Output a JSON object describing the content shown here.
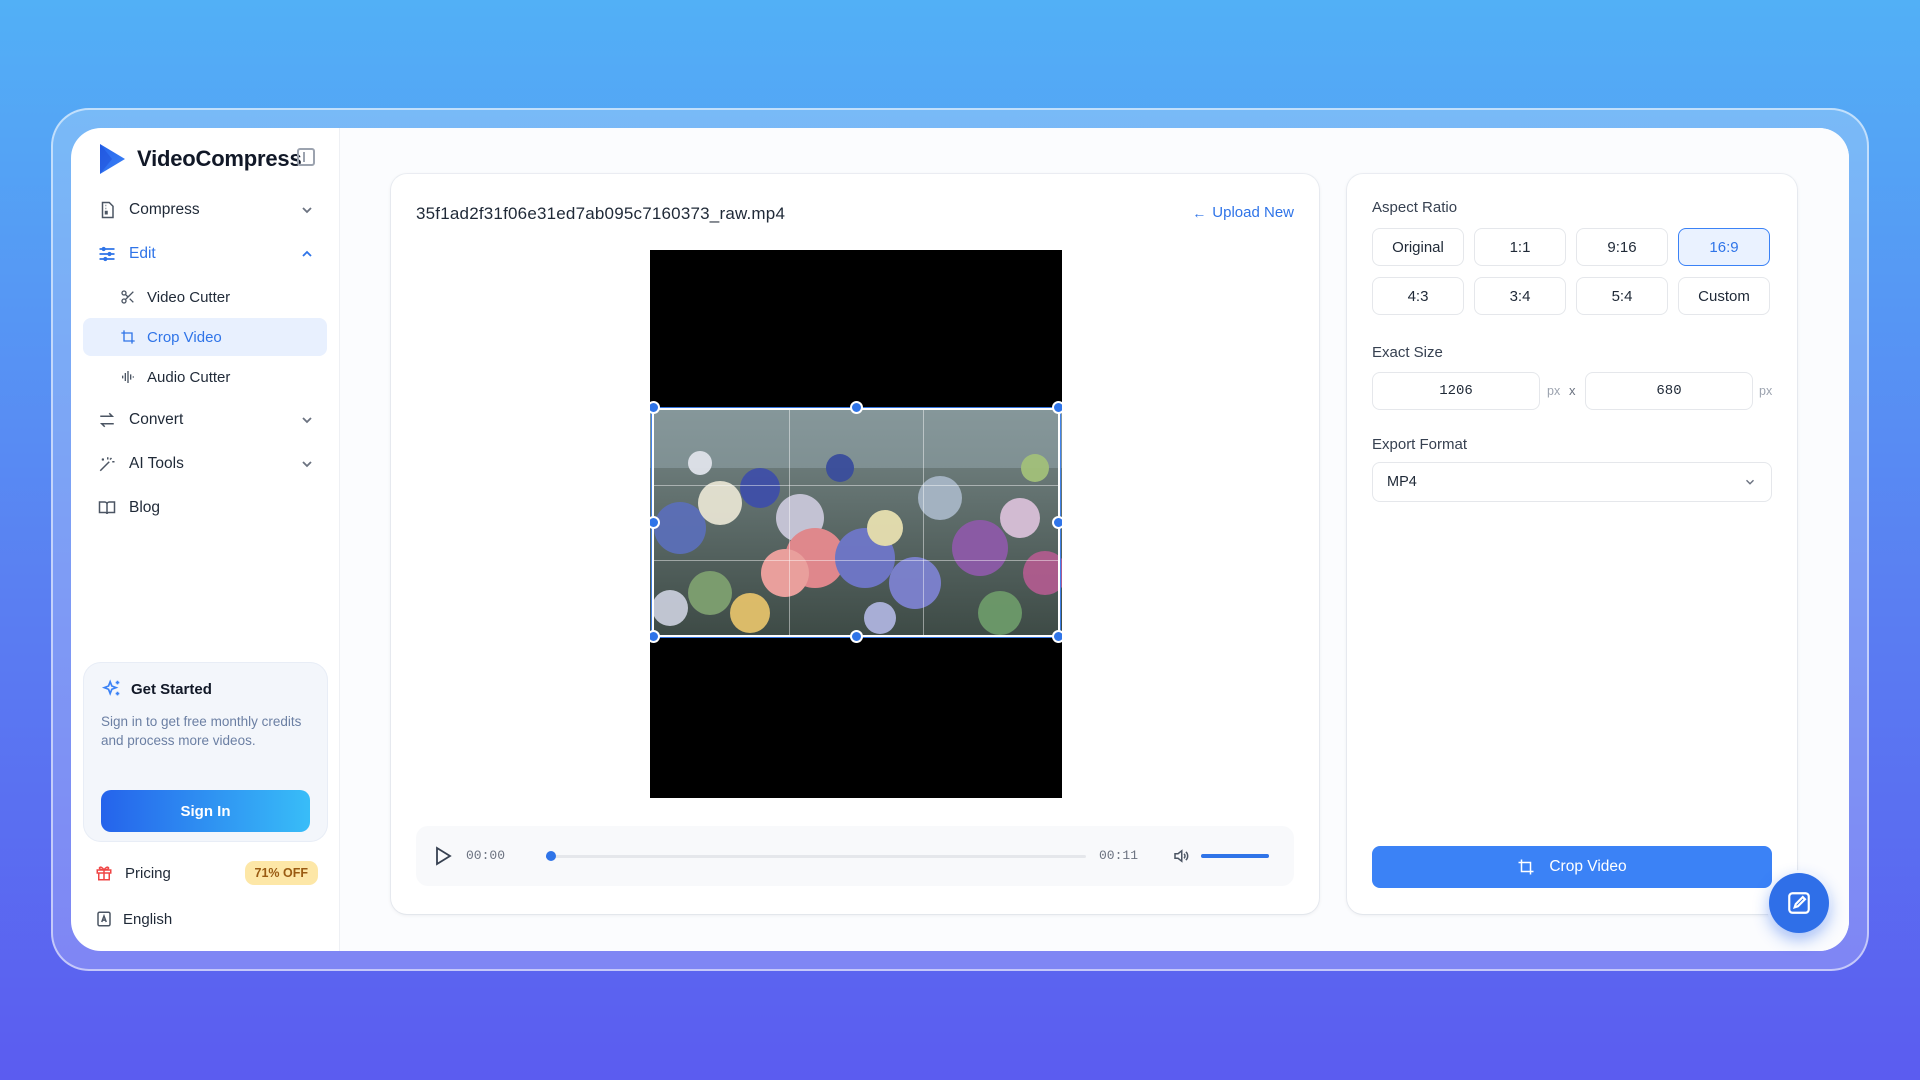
{
  "brand": {
    "name": "VideoCompress"
  },
  "sidebar": {
    "nav": [
      {
        "label": "Compress",
        "icon": "file-icon"
      },
      {
        "label": "Edit",
        "icon": "sliders-icon"
      },
      {
        "label": "Convert",
        "icon": "arrows-icon"
      },
      {
        "label": "AI Tools",
        "icon": "magic-wand-icon"
      },
      {
        "label": "Blog",
        "icon": "book-icon"
      }
    ],
    "edit_sub": [
      {
        "label": "Video Cutter",
        "icon": "scissors-icon"
      },
      {
        "label": "Crop Video",
        "icon": "crop-icon"
      },
      {
        "label": "Audio Cutter",
        "icon": "waveform-icon"
      }
    ],
    "get_started": {
      "title": "Get Started",
      "description": "Sign in to get free monthly credits and process more videos.",
      "button": "Sign In"
    },
    "pricing": {
      "label": "Pricing",
      "badge": "71% OFF"
    },
    "language": {
      "label": "English"
    }
  },
  "editor": {
    "file_name": "35f1ad2f31f06e31ed7ab095c7160373_raw.mp4",
    "upload_new": "Upload New",
    "player": {
      "current_time": "00:00",
      "total_time": "00:11",
      "progress": 0.01,
      "volume": 1.0
    }
  },
  "settings": {
    "aspect_ratio_label": "Aspect Ratio",
    "ratios": [
      "Original",
      "1:1",
      "9:16",
      "16:9",
      "4:3",
      "3:4",
      "5:4",
      "Custom"
    ],
    "selected_ratio": "16:9",
    "exact_size_label": "Exact Size",
    "width": "1206",
    "height": "680",
    "unit": "px",
    "times": "x",
    "export_format_label": "Export Format",
    "export_format": "MP4",
    "crop_button": "Crop Video"
  },
  "colors": {
    "accent": "#2f74e8",
    "button": "#3b82f6",
    "badge_bg": "#fde7a7"
  }
}
